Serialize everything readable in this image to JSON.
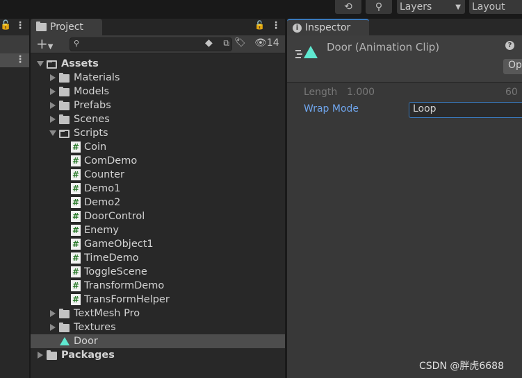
{
  "topbar": {
    "history_icon": "history-icon",
    "search_icon": "search-icon",
    "layers": "Layers",
    "layout": "Layout"
  },
  "project": {
    "tab": "Project",
    "hidden_count": "14",
    "tree": [
      {
        "label": "Assets",
        "level": 0,
        "type": "folder-open",
        "expanded": true,
        "bold": true
      },
      {
        "label": "Materials",
        "level": 1,
        "type": "folder"
      },
      {
        "label": "Models",
        "level": 1,
        "type": "folder"
      },
      {
        "label": "Prefabs",
        "level": 1,
        "type": "folder"
      },
      {
        "label": "Scenes",
        "level": 1,
        "type": "folder"
      },
      {
        "label": "Scripts",
        "level": 1,
        "type": "folder-open",
        "expanded": true
      },
      {
        "label": "Coin",
        "level": 2,
        "type": "script"
      },
      {
        "label": "ComDemo",
        "level": 2,
        "type": "script"
      },
      {
        "label": "Counter",
        "level": 2,
        "type": "script"
      },
      {
        "label": "Demo1",
        "level": 2,
        "type": "script"
      },
      {
        "label": "Demo2",
        "level": 2,
        "type": "script"
      },
      {
        "label": "DoorControl",
        "level": 2,
        "type": "script"
      },
      {
        "label": "Enemy",
        "level": 2,
        "type": "script"
      },
      {
        "label": "GameObject1",
        "level": 2,
        "type": "script"
      },
      {
        "label": "TimeDemo",
        "level": 2,
        "type": "script"
      },
      {
        "label": "ToggleScene",
        "level": 2,
        "type": "script"
      },
      {
        "label": "TransformDemo",
        "level": 2,
        "type": "script"
      },
      {
        "label": "TransFormHelper",
        "level": 2,
        "type": "script"
      },
      {
        "label": "TextMesh Pro",
        "level": 1,
        "type": "folder"
      },
      {
        "label": "Textures",
        "level": 1,
        "type": "folder"
      },
      {
        "label": "Door",
        "level": 1,
        "type": "anim",
        "selected": true
      },
      {
        "label": "Packages",
        "level": 0,
        "type": "folder",
        "bold": true
      }
    ]
  },
  "inspector": {
    "tab": "Inspector",
    "title": "Door (Animation Clip)",
    "open_btn": "Op",
    "length_label": "Length",
    "length_value": "1.000",
    "fps": "60",
    "wrap_label": "Wrap Mode",
    "wrap_value": "Loop",
    "accent": "#6fa5ec"
  },
  "watermark": "CSDN @胖虎6688"
}
